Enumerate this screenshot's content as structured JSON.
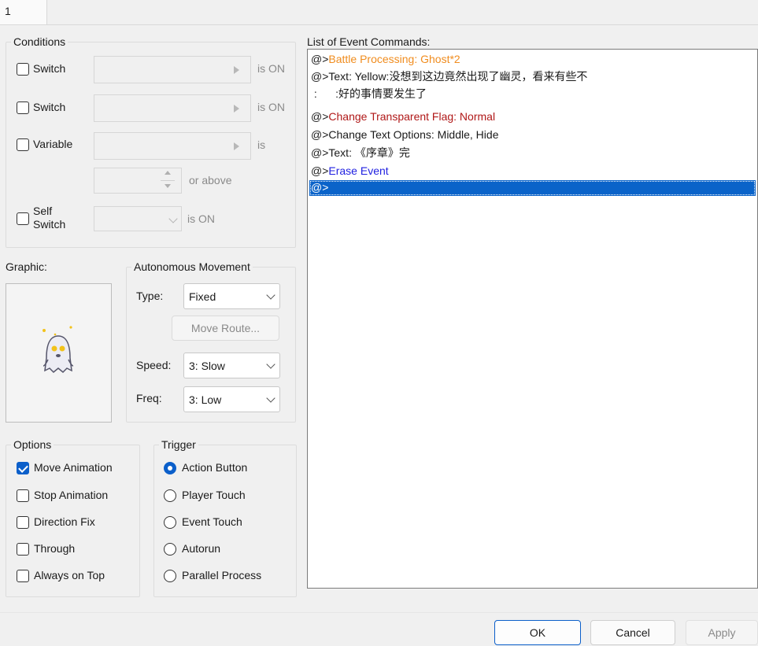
{
  "tab": {
    "label": "1"
  },
  "conditions": {
    "legend": "Conditions",
    "switch1": {
      "label": "Switch",
      "suffix": "is ON"
    },
    "switch2": {
      "label": "Switch",
      "suffix": "is ON"
    },
    "variable": {
      "label": "Variable",
      "suffix": "is",
      "or_above": "or above"
    },
    "self_switch": {
      "label_line1": "Self",
      "label_line2": "Switch",
      "suffix": "is ON"
    }
  },
  "graphic": {
    "label": "Graphic:",
    "sprite": "ghost-sprite"
  },
  "autonomous": {
    "legend": "Autonomous Movement",
    "type_label": "Type:",
    "type_value": "Fixed",
    "move_route": "Move Route...",
    "speed_label": "Speed:",
    "speed_value": "3: Slow",
    "freq_label": "Freq:",
    "freq_value": "3: Low"
  },
  "options": {
    "legend": "Options",
    "items": [
      {
        "label": "Move Animation",
        "checked": true
      },
      {
        "label": "Stop Animation",
        "checked": false
      },
      {
        "label": "Direction Fix",
        "checked": false
      },
      {
        "label": "Through",
        "checked": false
      },
      {
        "label": "Always on Top",
        "checked": false
      }
    ]
  },
  "trigger": {
    "legend": "Trigger",
    "items": [
      {
        "label": "Action Button",
        "checked": true
      },
      {
        "label": "Player Touch",
        "checked": false
      },
      {
        "label": "Event Touch",
        "checked": false
      },
      {
        "label": "Autorun",
        "checked": false
      },
      {
        "label": "Parallel Process",
        "checked": false
      }
    ]
  },
  "commands": {
    "label": "List of Event Commands:",
    "rows": [
      {
        "prefix": "@>",
        "text": "Battle Processing: Ghost*2",
        "color": "#f08c1e"
      },
      {
        "prefix": "@>",
        "text": "Text: Yellow:没想到这边竟然出现了幽灵，看来有些不",
        "color": "#1a1a1a"
      },
      {
        "prefix": " :",
        "text": "      :好的事情要发生了",
        "color": "#1a1a1a"
      },
      {
        "prefix": "@>",
        "text": "Change Transparent Flag: Normal",
        "color": "#b01818"
      },
      {
        "prefix": "@>",
        "text": "Change Text Options: Middle, Hide",
        "color": "#1a1a1a"
      },
      {
        "prefix": "@>",
        "text": "Text: 《序章》完",
        "color": "#1a1a1a"
      },
      {
        "prefix": "@>",
        "text": "Erase Event",
        "color": "#1f1fe0"
      }
    ],
    "selected_row": "@>"
  },
  "buttons": {
    "ok": "OK",
    "cancel": "Cancel",
    "apply": "Apply"
  },
  "colors": {
    "accent": "#0b5fca",
    "selection": "#0a63c9"
  }
}
